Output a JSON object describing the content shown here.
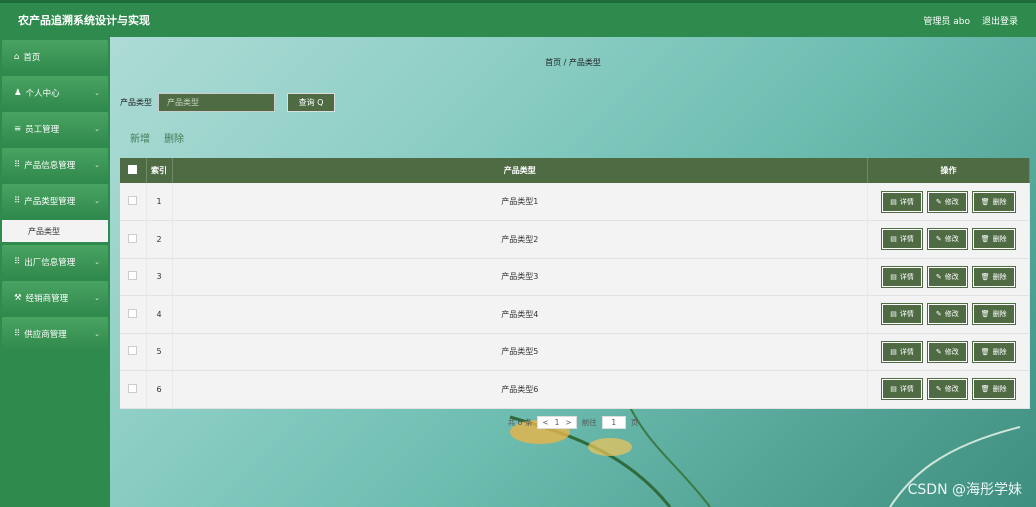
{
  "header": {
    "title": "农产品追溯系统设计与实现",
    "admin": "管理员 abo",
    "logout": "退出登录"
  },
  "sidebar": {
    "items": [
      {
        "icon": "⌂",
        "label": "首页",
        "chev": ""
      },
      {
        "icon": "♟",
        "label": "个人中心",
        "chev": "⌄"
      },
      {
        "icon": "≡",
        "label": "员工管理",
        "chev": "⌄"
      },
      {
        "icon": "⠿",
        "label": "产品信息管理",
        "chev": "⌄"
      },
      {
        "icon": "⠿",
        "label": "产品类型管理",
        "chev": "⌄"
      },
      {
        "icon": "⠿",
        "label": "出厂信息管理",
        "chev": "⌄"
      },
      {
        "icon": "⚒",
        "label": "经销商管理",
        "chev": "⌄"
      },
      {
        "icon": "⠿",
        "label": "供应商管理",
        "chev": "⌄"
      }
    ],
    "sub_item": "产品类型"
  },
  "breadcrumb": "首页 / 产品类型",
  "search": {
    "label": "产品类型",
    "placeholder": "产品类型",
    "button": "查询 Q"
  },
  "actions": {
    "add": "新增",
    "delete": "删除"
  },
  "table": {
    "headers": {
      "index": "索引",
      "type": "产品类型",
      "ops": "操作"
    },
    "rows": [
      {
        "index": "1",
        "type": "产品类型1"
      },
      {
        "index": "2",
        "type": "产品类型2"
      },
      {
        "index": "3",
        "type": "产品类型3"
      },
      {
        "index": "4",
        "type": "产品类型4"
      },
      {
        "index": "5",
        "type": "产品类型5"
      },
      {
        "index": "6",
        "type": "产品类型6"
      }
    ],
    "op_labels": {
      "detail": "详情",
      "edit": "修改",
      "remove": "删除"
    }
  },
  "pager": {
    "total": "共 6 条",
    "prev": "<",
    "current": "1",
    "next": ">",
    "goto": "前往",
    "page_input": "1",
    "page_unit": "页"
  },
  "watermark": "CSDN @海彤学妹",
  "colors": {
    "header": "#2f8a4e",
    "button": "#4e6b44"
  }
}
